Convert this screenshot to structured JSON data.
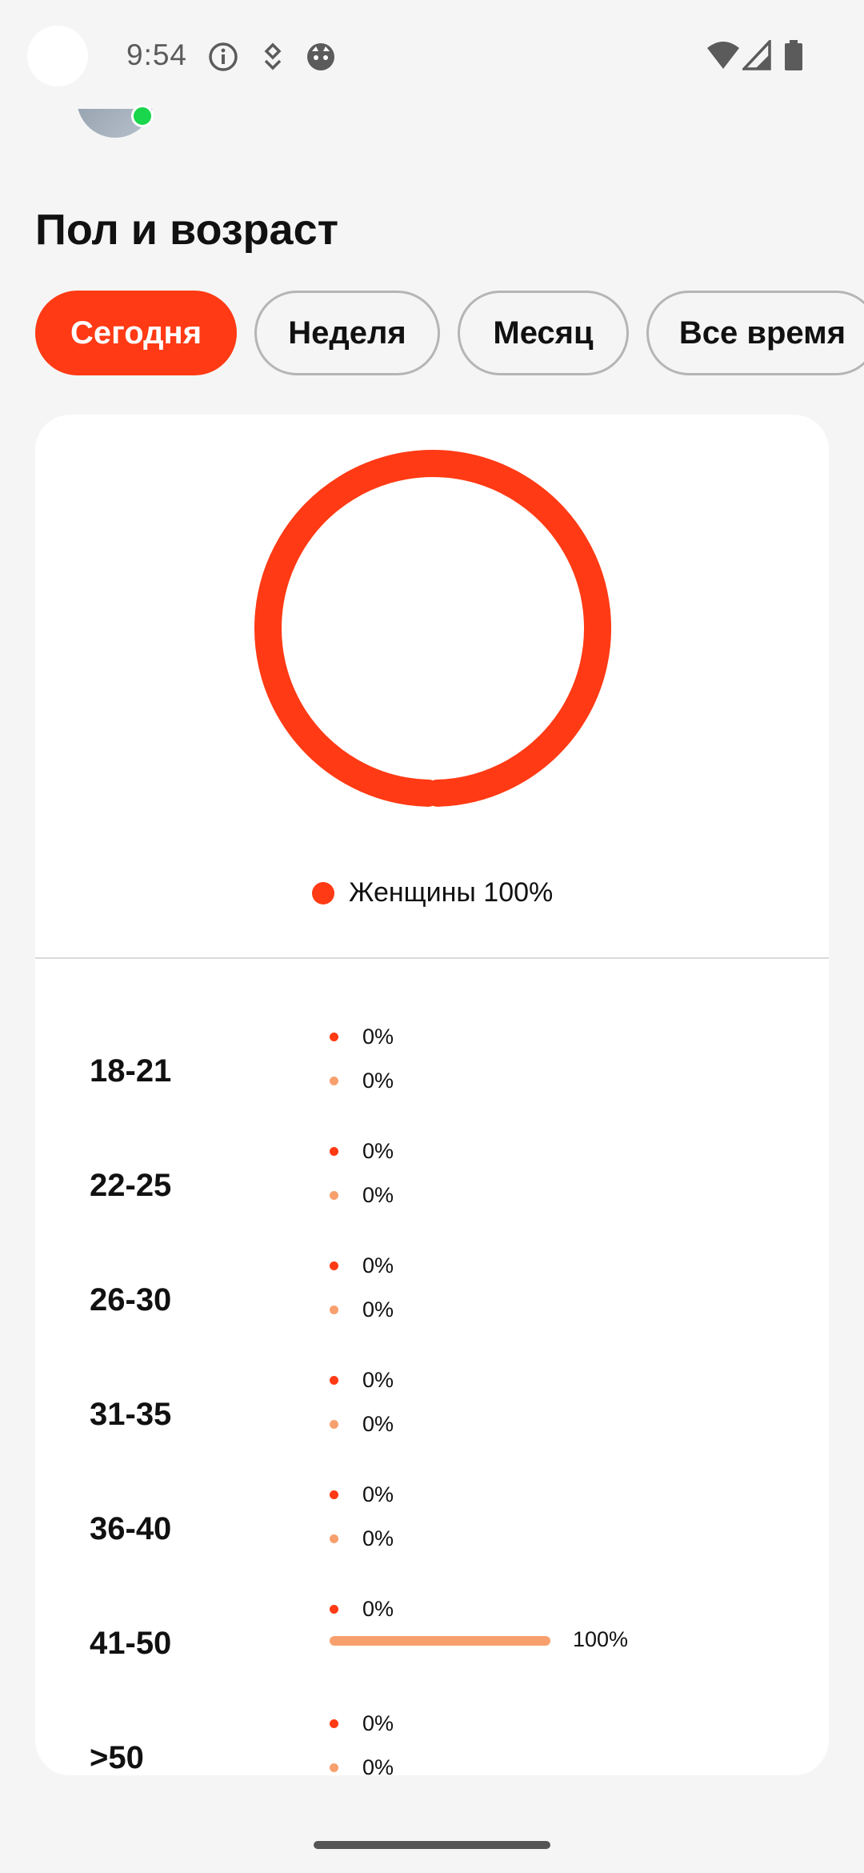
{
  "status_bar": {
    "time": "9:54",
    "left_icons": [
      "info-icon",
      "notification-icon",
      "cat-icon"
    ],
    "right_icons": [
      "wifi-icon",
      "signal-icon",
      "battery-icon"
    ]
  },
  "section": {
    "title": "Пол и возраст"
  },
  "tabs": [
    {
      "label": "Сегодня",
      "active": true
    },
    {
      "label": "Неделя",
      "active": false
    },
    {
      "label": "Месяц",
      "active": false
    },
    {
      "label": "Все время",
      "active": false
    }
  ],
  "colors": {
    "accent": "#ff3a14",
    "secondary": "#f7a06e"
  },
  "chart_data": {
    "type": "pie",
    "slices": [
      {
        "name": "Женщины",
        "value": 100
      }
    ],
    "legend": {
      "label": "Женщины 100%"
    }
  },
  "age_groups": [
    {
      "label": "18-21",
      "red": "0%",
      "orange": "0%",
      "orange_fraction": 0
    },
    {
      "label": "22-25",
      "red": "0%",
      "orange": "0%",
      "orange_fraction": 0
    },
    {
      "label": "26-30",
      "red": "0%",
      "orange": "0%",
      "orange_fraction": 0
    },
    {
      "label": "31-35",
      "red": "0%",
      "orange": "0%",
      "orange_fraction": 0
    },
    {
      "label": "36-40",
      "red": "0%",
      "orange": "0%",
      "orange_fraction": 0
    },
    {
      "label": "41-50",
      "red": "0%",
      "orange": "100%",
      "orange_fraction": 1
    },
    {
      "label": ">50",
      "red": "0%",
      "orange": "0%",
      "orange_fraction": 0
    }
  ]
}
